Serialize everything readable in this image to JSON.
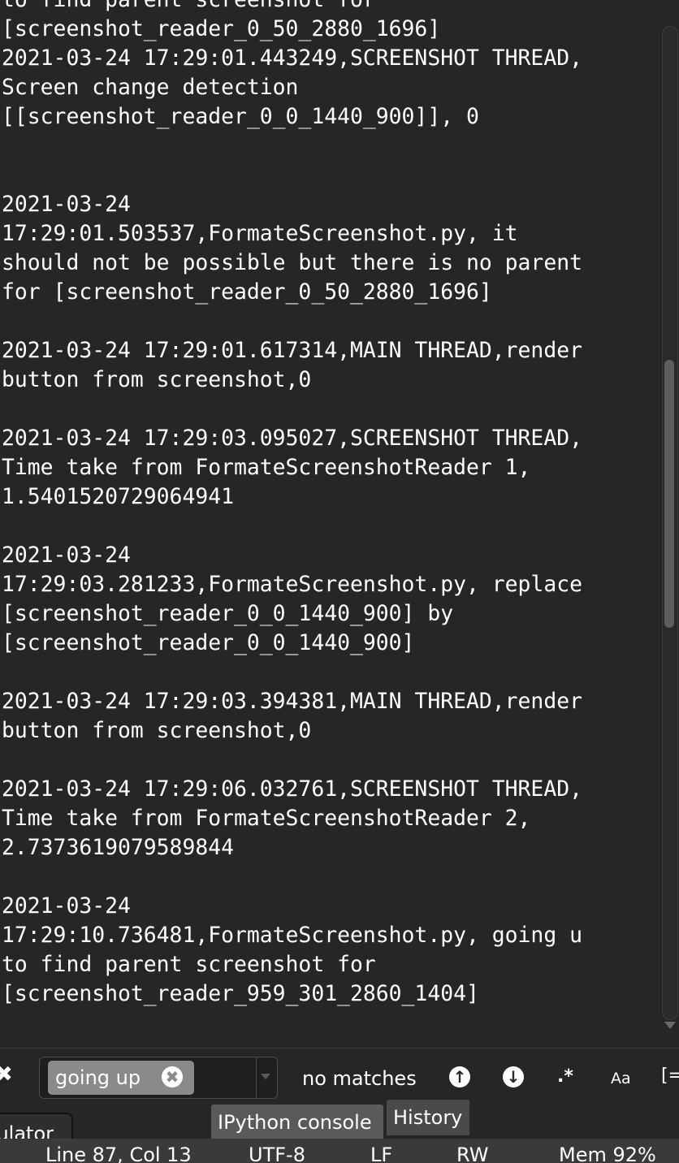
{
  "console": {
    "lines": [
      "to find parent screenshot for",
      "[screenshot_reader_0_50_2880_1696]",
      "2021-03-24 17:29:01.443249,SCREENSHOT THREAD,",
      "Screen change detection",
      "[[screenshot_reader_0_0_1440_900]], 0",
      "",
      "",
      "2021-03-24",
      "17:29:01.503537,FormateScreenshot.py, it",
      "should not be possible but there is no parent",
      "for [screenshot_reader_0_50_2880_1696]",
      "",
      "2021-03-24 17:29:01.617314,MAIN THREAD,render",
      "button from screenshot,0",
      "",
      "2021-03-24 17:29:03.095027,SCREENSHOT THREAD,",
      "Time take from FormateScreenshotReader 1,",
      "1.5401520729064941",
      "",
      "2021-03-24",
      "17:29:03.281233,FormateScreenshot.py, replace",
      "[screenshot_reader_0_0_1440_900] by",
      "[screenshot_reader_0_0_1440_900]",
      "",
      "2021-03-24 17:29:03.394381,MAIN THREAD,render",
      "button from screenshot,0",
      "",
      "2021-03-24 17:29:06.032761,SCREENSHOT THREAD,",
      "Time take from FormateScreenshotReader 2,",
      "2.7373619079589844",
      "",
      "2021-03-24",
      "17:29:10.736481,FormateScreenshot.py, going u",
      "to find parent screenshot for",
      "[screenshot_reader_959_301_2860_1404]"
    ]
  },
  "findbar": {
    "close_icon": "✖",
    "query": "going up",
    "clear_icon": "✖",
    "status": "no matches",
    "prev_icon": "↑",
    "next_icon": "↓",
    "regex_label": ".*",
    "case_label": "Aa",
    "more_label": "[="
  },
  "tabs": {
    "side_tab_label": "ulator",
    "ipython_console": "IPython console",
    "history": "History"
  },
  "statusbar": {
    "position": "Line 87, Col 13",
    "encoding": "UTF-8",
    "eol": "LF",
    "permissions": "RW",
    "memory": "Mem 92%"
  },
  "colors": {
    "background": "#262626",
    "text": "#ffffff",
    "active_tab": "#5a5a5a",
    "search_highlight": "#8a8a8a"
  },
  "scrollbar": {
    "scroll_position": 0.46,
    "visible_fraction": 0.27
  }
}
